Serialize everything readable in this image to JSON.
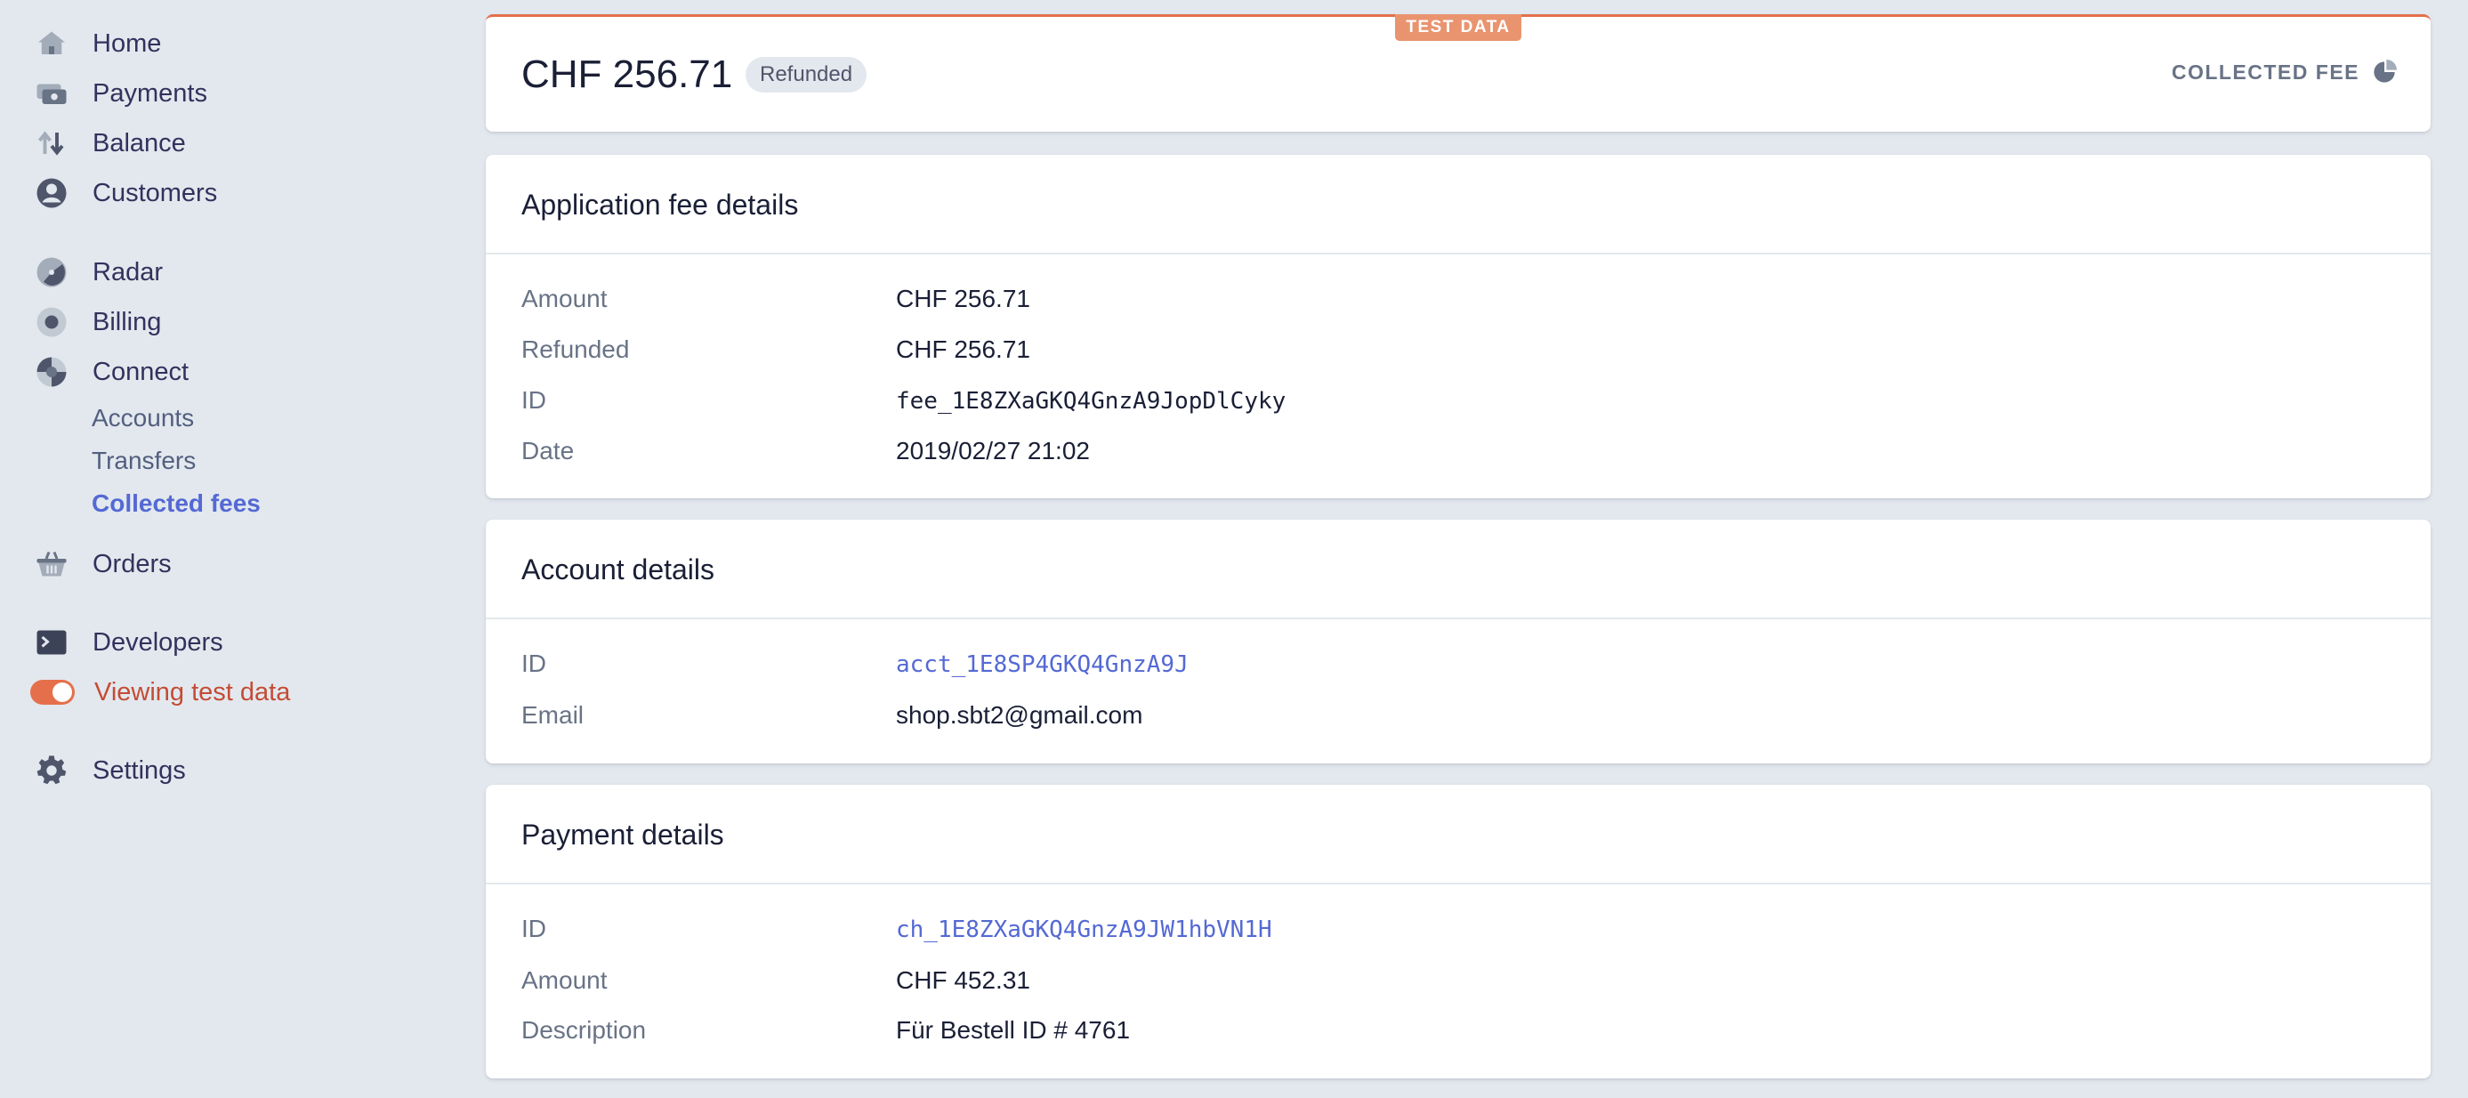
{
  "sidebar": {
    "items": [
      {
        "label": "Home",
        "icon": "home-icon"
      },
      {
        "label": "Payments",
        "icon": "payments-icon"
      },
      {
        "label": "Balance",
        "icon": "balance-icon"
      },
      {
        "label": "Customers",
        "icon": "customers-icon"
      },
      {
        "label": "Radar",
        "icon": "radar-icon"
      },
      {
        "label": "Billing",
        "icon": "billing-icon"
      },
      {
        "label": "Connect",
        "icon": "connect-icon"
      },
      {
        "label": "Orders",
        "icon": "orders-icon"
      },
      {
        "label": "Developers",
        "icon": "developers-icon"
      },
      {
        "label": "Viewing test data",
        "icon": "toggle"
      },
      {
        "label": "Settings",
        "icon": "gear-icon"
      }
    ],
    "connect_sub": [
      {
        "label": "Accounts"
      },
      {
        "label": "Transfers"
      },
      {
        "label": "Collected fees",
        "active": true
      }
    ]
  },
  "header": {
    "test_badge": "TEST DATA",
    "amount": "CHF 256.71",
    "status": "Refunded",
    "type_label": "COLLECTED FEE"
  },
  "fee_details": {
    "title": "Application fee details",
    "rows": [
      {
        "label": "Amount",
        "value": "CHF 256.71"
      },
      {
        "label": "Refunded",
        "value": "CHF 256.71"
      },
      {
        "label": "ID",
        "value": "fee_1E8ZXaGKQ4GnzA9JopDlCyky"
      },
      {
        "label": "Date",
        "value": "2019/02/27 21:02"
      }
    ]
  },
  "account_details": {
    "title": "Account details",
    "rows": [
      {
        "label": "ID",
        "value": "acct_1E8SP4GKQ4GnzA9J"
      },
      {
        "label": "Email",
        "value": "shop.sbt2@gmail.com"
      }
    ]
  },
  "payment_details": {
    "title": "Payment details",
    "rows": [
      {
        "label": "ID",
        "value": "ch_1E8ZXaGKQ4GnzA9JW1hbVN1H"
      },
      {
        "label": "Amount",
        "value": "CHF 452.31"
      },
      {
        "label": "Description",
        "value": "Für Bestell ID # 4761"
      }
    ]
  },
  "colors": {
    "accent": "#5469d4",
    "test_orange": "#e56f4a",
    "background": "#e3e8ee"
  }
}
